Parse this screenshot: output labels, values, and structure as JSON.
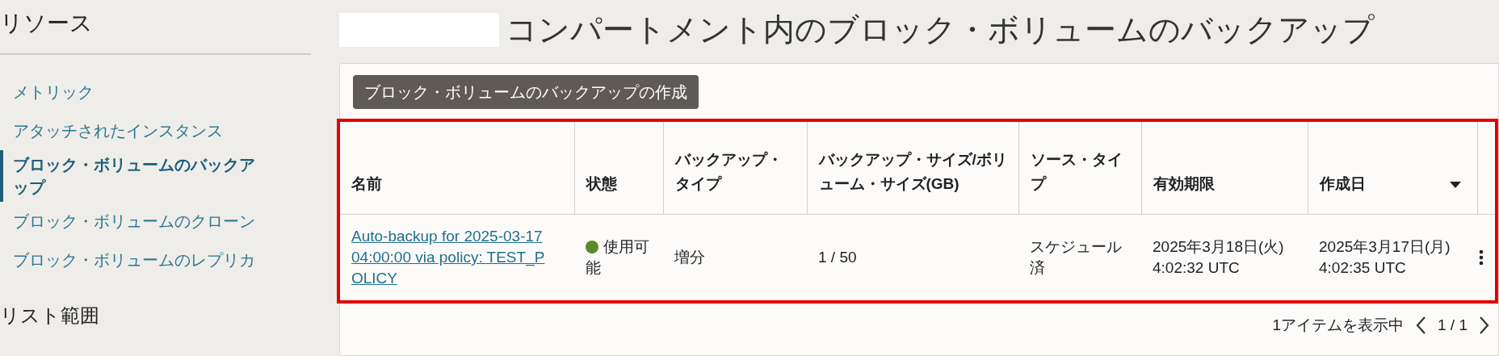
{
  "sidebar": {
    "title": "リソース",
    "items": [
      {
        "label": "メトリック",
        "selected": false
      },
      {
        "label": "アタッチされたインスタンス",
        "selected": false
      },
      {
        "label": "ブロック・ボリュームのバックアップ",
        "selected": true
      },
      {
        "label": "ブロック・ボリュームのクローン",
        "selected": false
      },
      {
        "label": "ブロック・ボリュームのレプリカ",
        "selected": false
      }
    ],
    "section_title": "リスト範囲"
  },
  "page": {
    "title": "コンパートメント内のブロック・ボリュームのバックアップ"
  },
  "create_button": "ブロック・ボリュームのバックアップの作成",
  "table": {
    "highlighted": true,
    "columns": [
      {
        "label": "名前",
        "sorted": false
      },
      {
        "label": "状態",
        "sorted": false
      },
      {
        "label": "バックアップ・タイプ",
        "sorted": false
      },
      {
        "label": "バックアップ・サイズ/ボリューム・サイズ(GB)",
        "sorted": false
      },
      {
        "label": "ソース・タイプ",
        "sorted": false
      },
      {
        "label": "有効期限",
        "sorted": false
      },
      {
        "label": "作成日",
        "sorted": true
      }
    ],
    "rows": [
      {
        "name": "Auto-backup for 2025-03-17 04:00:00 via policy: TEST_POLICY",
        "status": {
          "label": "使用可能",
          "color": "#5a8a2a"
        },
        "backup_type": "増分",
        "size": "1 / 50",
        "source_type": "スケジュール済",
        "expires": "2025年3月18日(火) 4:02:32 UTC",
        "created": "2025年3月17日(月) 4:02:35 UTC"
      }
    ]
  },
  "footer": {
    "count": "1アイテムを表示中",
    "page": "1 / 1"
  }
}
